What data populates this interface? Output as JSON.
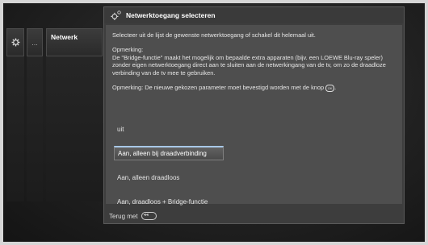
{
  "nav": {
    "tabs": [
      {
        "id": "gear",
        "icon": "gear-icon"
      },
      {
        "id": "more",
        "label": "..."
      },
      {
        "id": "network",
        "label": "Netwerk"
      }
    ]
  },
  "dialog": {
    "icon": "gear-network-icon",
    "title": "Netwerktoegang selecteren",
    "intro": "Selecteer uit de lijst de gewenste netwerktoegang of schakel dit helemaal uit.",
    "note_heading": "Opmerking:",
    "note_text": "De \"Bridge-functie\" maakt het mogelijk om bepaalde extra apparaten (bijv. een LOEWE Blu-ray speler) zonder eigen netwerktoegang direct aan te sluiten aan de netwerkingang van de tv, om zo de draadloze verbinding van de tv mee te gebruiken.",
    "note2": "Opmerking: De nieuwe gekozen parameter moet bevestigd worden met de knop",
    "ok_label": "OK",
    "options": [
      "uit",
      "Aan, alleen bij draadverbinding",
      "Aan, alleen draadloos",
      "Aan, draadloos + Bridge-functie"
    ],
    "selected_index": 1,
    "footer_back": "Terug met"
  },
  "colors": {
    "selection_accent": "#a8c8e8",
    "dialog_bg": "#4e4e4e"
  }
}
